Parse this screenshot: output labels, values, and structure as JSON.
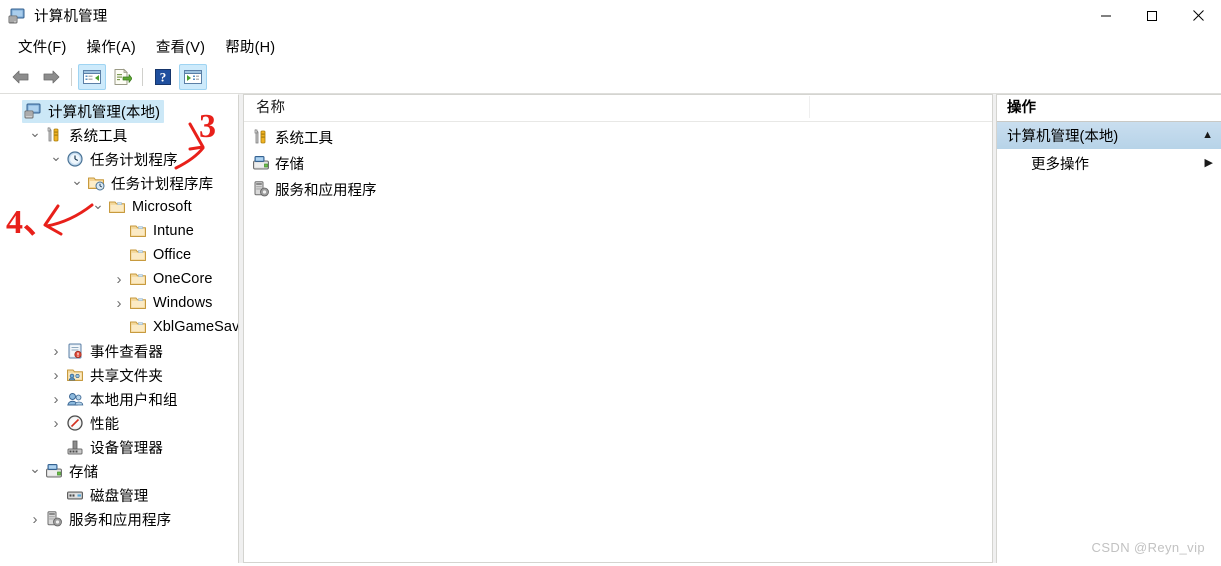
{
  "window": {
    "title": "计算机管理",
    "icon": "computer-management-icon",
    "controls": {
      "minimize": "minimize-icon",
      "maximize": "maximize-icon",
      "close": "close-icon"
    }
  },
  "menubar": {
    "items": [
      {
        "label": "文件(F)",
        "name": "menu-file"
      },
      {
        "label": "操作(A)",
        "name": "menu-action"
      },
      {
        "label": "查看(V)",
        "name": "menu-view"
      },
      {
        "label": "帮助(H)",
        "name": "menu-help"
      }
    ]
  },
  "toolbar": {
    "buttons": [
      {
        "name": "back-arrow-icon",
        "active": false
      },
      {
        "name": "forward-arrow-icon",
        "active": false
      },
      {
        "name": "show-hide-tree-icon",
        "active": true
      },
      {
        "name": "export-list-icon",
        "active": false
      },
      {
        "name": "help-icon",
        "active": false
      },
      {
        "name": "show-hide-action-pane-icon",
        "active": true
      }
    ]
  },
  "tree": {
    "items": [
      {
        "label": "计算机管理(本地)",
        "indent": 0,
        "twisty": "none",
        "icon": "computer-icon",
        "selected": true
      },
      {
        "label": "系统工具",
        "indent": 1,
        "twisty": "expanded",
        "icon": "system-tools-icon",
        "selected": false
      },
      {
        "label": "任务计划程序",
        "indent": 2,
        "twisty": "expanded",
        "icon": "clock-icon",
        "selected": false
      },
      {
        "label": "任务计划程序库",
        "indent": 3,
        "twisty": "expanded",
        "icon": "task-library-icon",
        "selected": false
      },
      {
        "label": "Microsoft",
        "indent": 4,
        "twisty": "expanded",
        "icon": "folder-icon",
        "selected": false
      },
      {
        "label": "Intune",
        "indent": 5,
        "twisty": "none",
        "icon": "folder-icon",
        "selected": false
      },
      {
        "label": "Office",
        "indent": 5,
        "twisty": "none",
        "icon": "folder-icon",
        "selected": false
      },
      {
        "label": "OneCore",
        "indent": 5,
        "twisty": "collapsed",
        "icon": "folder-icon",
        "selected": false
      },
      {
        "label": "Windows",
        "indent": 5,
        "twisty": "collapsed",
        "icon": "folder-icon",
        "selected": false
      },
      {
        "label": "XblGameSave",
        "indent": 5,
        "twisty": "none",
        "icon": "folder-icon",
        "selected": false
      },
      {
        "label": "事件查看器",
        "indent": 2,
        "twisty": "collapsed",
        "icon": "event-viewer-icon",
        "selected": false
      },
      {
        "label": "共享文件夹",
        "indent": 2,
        "twisty": "collapsed",
        "icon": "shared-folders-icon",
        "selected": false
      },
      {
        "label": "本地用户和组",
        "indent": 2,
        "twisty": "collapsed",
        "icon": "local-users-groups-icon",
        "selected": false
      },
      {
        "label": "性能",
        "indent": 2,
        "twisty": "collapsed",
        "icon": "performance-icon",
        "selected": false
      },
      {
        "label": "设备管理器",
        "indent": 2,
        "twisty": "none",
        "icon": "device-manager-icon",
        "selected": false
      },
      {
        "label": "存储",
        "indent": 1,
        "twisty": "expanded",
        "icon": "storage-icon",
        "selected": false
      },
      {
        "label": "磁盘管理",
        "indent": 2,
        "twisty": "none",
        "icon": "disk-management-icon",
        "selected": false
      },
      {
        "label": "服务和应用程序",
        "indent": 1,
        "twisty": "collapsed",
        "icon": "services-apps-icon",
        "selected": false
      }
    ]
  },
  "list": {
    "columns": [
      "名称"
    ],
    "rows": [
      {
        "label": "系统工具",
        "icon": "system-tools-icon"
      },
      {
        "label": "存储",
        "icon": "storage-icon"
      },
      {
        "label": "服务和应用程序",
        "icon": "services-apps-icon"
      }
    ]
  },
  "actions": {
    "title": "操作",
    "group": {
      "label": "计算机管理(本地)",
      "arrow": "triangle-up-icon"
    },
    "items": [
      {
        "label": "更多操作",
        "arrow": "triangle-right-icon"
      }
    ]
  },
  "annotations": {
    "marks": [
      {
        "text": "3",
        "name": "annotation-3"
      },
      {
        "text": "4、",
        "name": "annotation-4"
      }
    ],
    "color": "#e8201a"
  },
  "watermark": {
    "text": "CSDN @Reyn_vip"
  }
}
